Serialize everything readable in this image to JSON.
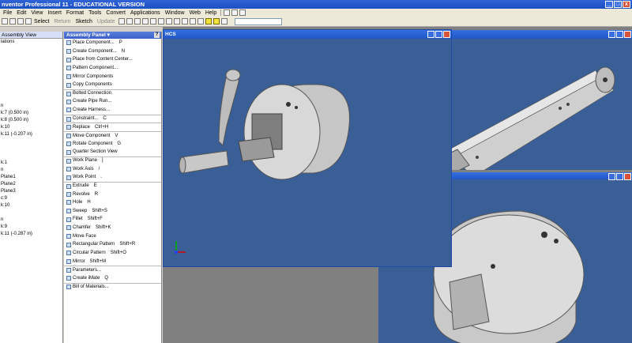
{
  "app": {
    "title": "nventor Professional 11 - EDUCATIONAL VERSION"
  },
  "menubar": {
    "items": [
      "File",
      "Edit",
      "View",
      "Insert",
      "Format",
      "Tools",
      "Convert",
      "Applications",
      "Window",
      "Web",
      "Help"
    ]
  },
  "toolbar": {
    "select_label": "Select",
    "return_label": "Return",
    "sketch_label": "Sketch",
    "update_label": "Update"
  },
  "browser": {
    "tab_label": "Assembly View",
    "rows": [
      "lations",
      "",
      "",
      "",
      "",
      "",
      "",
      "",
      "",
      "n",
      "k:7 (0.500 in)",
      "k:8 (0.500 in)",
      "k:10",
      "k:11 (-0.207 in)",
      "",
      "",
      "",
      "k:1",
      "n",
      "Plane1",
      "Plane2",
      "Plane3",
      "c:9",
      "k:10",
      "",
      "n",
      "k:9",
      "k:11 (-0.287 in)"
    ]
  },
  "panel": {
    "title": "Assembly Panel",
    "commands": [
      {
        "label": "Place Component...",
        "shortcut": "P"
      },
      {
        "label": "Create Component...",
        "shortcut": "N"
      },
      {
        "label": "Place from Content Center...",
        "shortcut": ""
      },
      {
        "label": "Pattern Component...",
        "shortcut": ""
      },
      {
        "label": "Mirror Components",
        "shortcut": ""
      },
      {
        "label": "Copy Components",
        "shortcut": ""
      },
      {
        "label": "Bolted Connection",
        "shortcut": ""
      },
      {
        "label": "Create Pipe Run...",
        "shortcut": ""
      },
      {
        "label": "Create Harness...",
        "shortcut": ""
      },
      {
        "label": "Constraint...",
        "shortcut": "C"
      },
      {
        "label": "Replace",
        "shortcut": "Ctrl+H"
      },
      {
        "label": "Move Component",
        "shortcut": "V"
      },
      {
        "label": "Rotate Component",
        "shortcut": "G"
      },
      {
        "label": "Quarter Section View",
        "shortcut": ""
      },
      {
        "label": "Work Plane",
        "shortcut": "]"
      },
      {
        "label": "Work Axis",
        "shortcut": "/"
      },
      {
        "label": "Work Point",
        "shortcut": "."
      },
      {
        "label": "Extrude",
        "shortcut": "E"
      },
      {
        "label": "Revolve",
        "shortcut": "R"
      },
      {
        "label": "Hole",
        "shortcut": "H"
      },
      {
        "label": "Sweep",
        "shortcut": "Shift+S"
      },
      {
        "label": "Fillet",
        "shortcut": "Shift+F"
      },
      {
        "label": "Chamfer",
        "shortcut": "Shift+K"
      },
      {
        "label": "Move Face",
        "shortcut": ""
      },
      {
        "label": "Rectangular Pattern",
        "shortcut": "Shift+R"
      },
      {
        "label": "Circular Pattern",
        "shortcut": "Shift+O"
      },
      {
        "label": "Mirror",
        "shortcut": "Shift+M"
      },
      {
        "label": "Parameters...",
        "shortcut": ""
      },
      {
        "label": "Create iMate",
        "shortcut": "Q"
      },
      {
        "label": "Bill of Materials...",
        "shortcut": ""
      }
    ]
  },
  "viewer_main": {
    "title": "HCS"
  },
  "colors": {
    "viewport": "#3a5f97",
    "title_blue": "#2156c8",
    "part_gray": "#c8c8c8"
  }
}
